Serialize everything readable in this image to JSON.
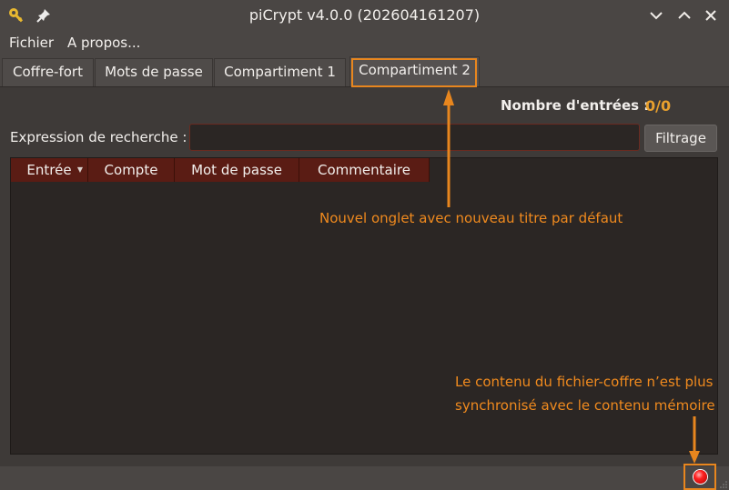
{
  "window": {
    "title": "piCrypt v4.0.0 (202604161207)",
    "app_icon": "key-icon",
    "pin_icon": "pin-icon",
    "controls": [
      "minimize-icon",
      "maximize-icon",
      "close-icon"
    ]
  },
  "menu": {
    "items": [
      {
        "label": "Fichier"
      },
      {
        "label": "A propos..."
      }
    ]
  },
  "tabs": [
    {
      "label": "Coffre-fort"
    },
    {
      "label": "Mots de passe"
    },
    {
      "label": "Compartiment 1"
    },
    {
      "label": "Compartiment 2",
      "active": true
    }
  ],
  "entries": {
    "label": "Nombre d'entrées :",
    "value": "0/0"
  },
  "search": {
    "label": "Expression de recherche :",
    "value": "",
    "button": "Filtrage"
  },
  "table": {
    "columns": [
      "Entrée",
      "Compte",
      "Mot de passe",
      "Commentaire"
    ],
    "rows": []
  },
  "annotations": {
    "tab_note": "Nouvel onglet avec nouveau titre par défaut",
    "sync_note_line1": "Le contenu du fichier-coffre n’est plus",
    "sync_note_line2": "synchronisé avec le contenu mémoire"
  },
  "status": {
    "led_color": "#ff2020"
  },
  "colors": {
    "accent": "#e8861e",
    "count": "#e8a02e",
    "header": "#5a1c14",
    "background": "#4a4644"
  }
}
